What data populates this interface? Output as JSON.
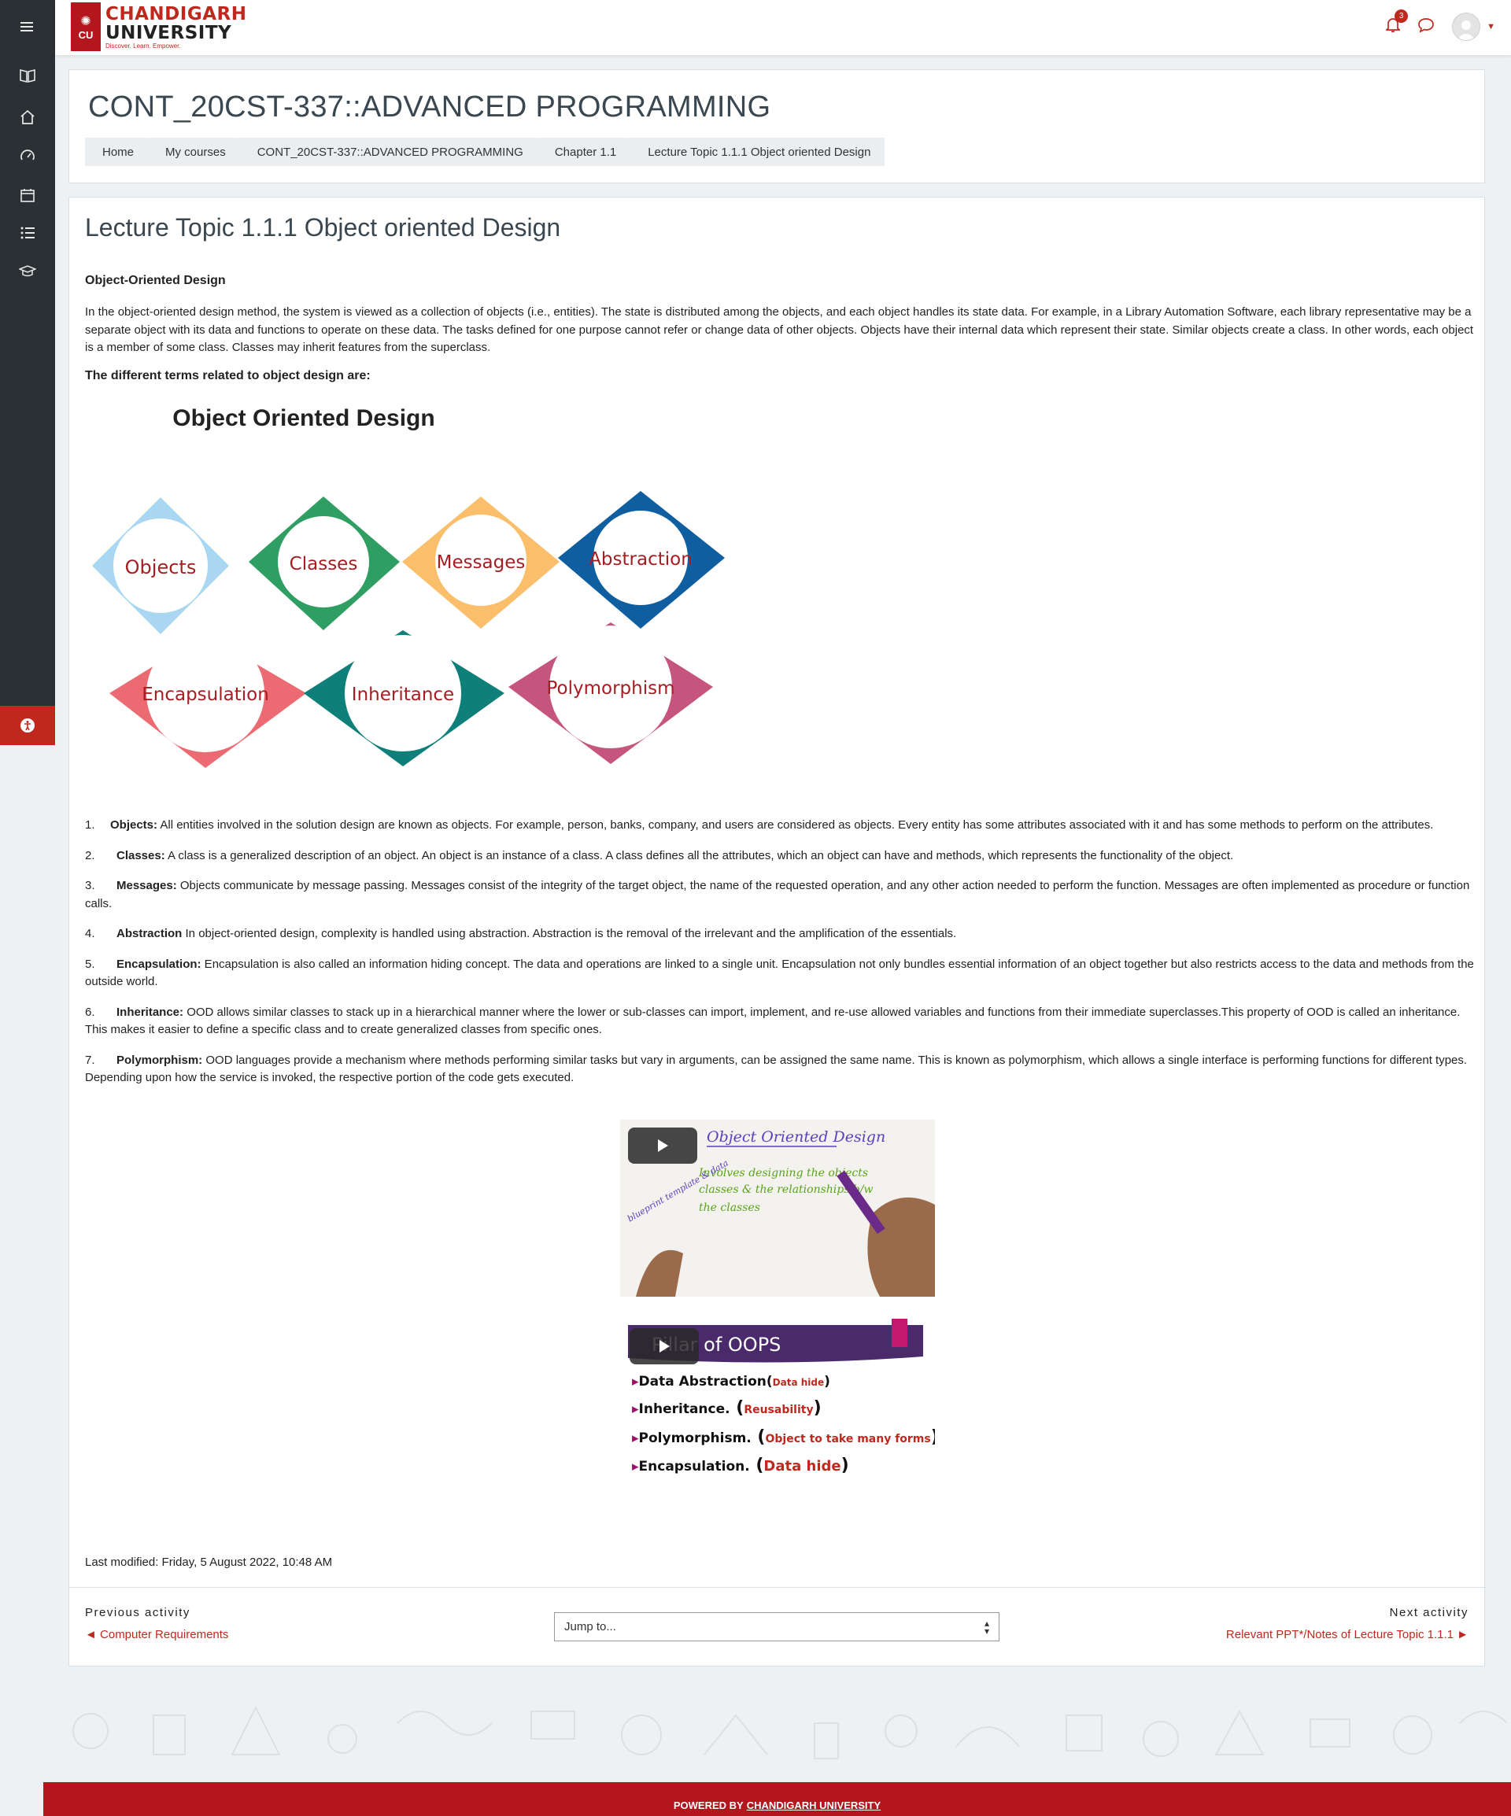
{
  "header": {
    "logo_line1": "CHANDIGARH",
    "logo_line2": "UNIVERSITY",
    "logo_tagline": "Discover. Learn. Empower.",
    "notification_count": "3"
  },
  "sidebar": {
    "items": [
      {
        "icon": "hamburger-menu-icon"
      },
      {
        "icon": "book-icon"
      },
      {
        "icon": "home-icon"
      },
      {
        "icon": "dashboard-icon"
      },
      {
        "icon": "calendar-icon"
      },
      {
        "icon": "list-icon"
      },
      {
        "icon": "graduation-cap-icon"
      }
    ],
    "accessibility_icon": "accessibility-icon"
  },
  "page_header": {
    "course_title": "CONT_20CST-337::ADVANCED PROGRAMMING",
    "breadcrumb": [
      "Home",
      "My courses",
      "CONT_20CST-337::ADVANCED PROGRAMMING",
      "Chapter 1.1",
      "Lecture Topic 1.1.1 Object oriented Design"
    ]
  },
  "main": {
    "title": "Lecture Topic 1.1.1 Object oriented Design",
    "section_heading": "Object-Oriented Design",
    "intro": "In the object-oriented design method, the system is viewed as a collection of objects (i.e., entities). The state is distributed among the objects, and each object handles its state data. For example, in a Library Automation Software, each library representative may be a separate object with its data and functions to operate on these data. The tasks defined for one purpose cannot refer or change data of other objects. Objects have their internal data which represent their state. Similar objects create a class. In other words, each object is a member of some class. Classes may inherit features from the superclass.",
    "terms_heading": "The different terms related to object design are:",
    "diagram": {
      "title": "Object Oriented Design",
      "items": [
        {
          "label": "Objects",
          "color": "#a9d7f2"
        },
        {
          "label": "Classes",
          "color": "#2f9e62"
        },
        {
          "label": "Messages",
          "color": "#fbbf6c"
        },
        {
          "label": "Abstraction",
          "color": "#0f5fa0"
        },
        {
          "label": "Encapsulation",
          "color": "#ec6a72"
        },
        {
          "label": "Inheritance",
          "color": "#0f7f7a"
        },
        {
          "label": "Polymorphism",
          "color": "#c6557e"
        }
      ]
    },
    "terms": [
      {
        "num": "1.",
        "term": "Objects:",
        "text": " All entities involved in the solution design are known as objects. For example, person, banks, company, and users are considered as objects. Every entity has some attributes associated with it and has some methods to perform on the attributes."
      },
      {
        "num": "2.",
        "term": "Classes:",
        "text": " A class is a generalized description of an object. An object is an instance of a class. A class defines all the attributes, which an object can have and methods, which represents the functionality of the object."
      },
      {
        "num": "3.",
        "term": "Messages:",
        "text": " Objects communicate by message passing. Messages consist of the integrity of the target object, the name of the requested operation, and any other action needed to perform the function. Messages are often implemented as procedure or function calls."
      },
      {
        "num": "4.",
        "term": "Abstraction",
        "text": " In object-oriented design, complexity is handled using abstraction. Abstraction is the removal of the irrelevant and the amplification of the essentials."
      },
      {
        "num": "5.",
        "term": "Encapsulation:",
        "text": " Encapsulation is also called an information hiding concept. The data and operations are linked to a single unit. Encapsulation not only bundles essential information of an object together but also restricts access to the data and methods from the outside world."
      },
      {
        "num": "6.",
        "term": "Inheritance:",
        "text": " OOD allows similar classes to stack up in a hierarchical manner where the lower or sub-classes can import, implement, and re-use allowed variables and functions from their immediate superclasses.This property of OOD is called an inheritance. This makes it easier to define a specific class and to create generalized classes from specific ones."
      },
      {
        "num": "7.",
        "term": "Polymorphism:",
        "text": " OOD languages provide a mechanism where methods performing similar tasks but vary in arguments, can be assigned the same name. This is known as polymorphism, which allows a single interface is performing functions for different types. Depending upon how the service is invoked, the respective portion of the code gets executed."
      }
    ],
    "video1": {
      "title": "Object Oriented Design",
      "line1": "Involves designing the objects",
      "line2": "classes & the relationships b/w",
      "line3": "the classes",
      "side": "blueprint template & data"
    },
    "video2": {
      "banner": "Pillar of OOPS",
      "rows": [
        {
          "main": "Data Abstraction",
          "note": "Data hide"
        },
        {
          "main": "Inheritance.",
          "note": "Reusability"
        },
        {
          "main": "Polymorphism.",
          "note": "Object to take many forms"
        },
        {
          "main": "Encapsulation.",
          "note": "Data hide"
        }
      ]
    },
    "last_modified": "Last modified: Friday, 5 August 2022, 10:48 AM"
  },
  "nav": {
    "previous_label": "Previous activity",
    "previous_link": "◄ Computer Requirements",
    "jump_placeholder": "Jump to...",
    "next_label": "Next activity",
    "next_link": "Relevant PPT*/Notes of Lecture Topic 1.1.1 ►"
  },
  "footer": {
    "prefix": "POWERED BY",
    "link": "CHANDIGARH UNIVERSITY"
  },
  "colors": {
    "brand_red": "#c0281e",
    "sidebar": "#2b3035"
  }
}
